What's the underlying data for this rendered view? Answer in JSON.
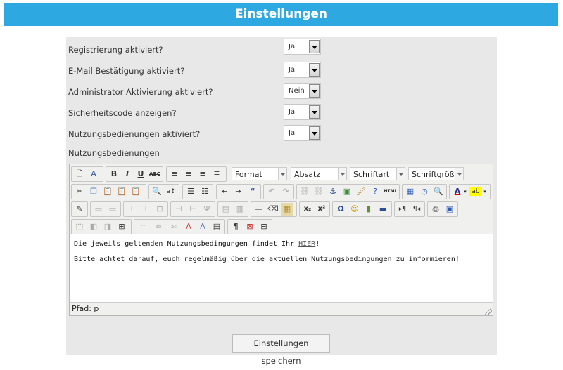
{
  "header": {
    "title": "Einstellungen"
  },
  "settings": [
    {
      "label": "Registrierung aktiviert?",
      "value": "Ja"
    },
    {
      "label": "E-Mail Bestätigung aktiviert?",
      "value": "Ja"
    },
    {
      "label": "Administrator Aktivierung aktiviert?",
      "value": "Nein"
    },
    {
      "label": "Sicherheitscode anzeigen?",
      "value": "Ja"
    },
    {
      "label": "Nutzungsbedienungen aktiviert?",
      "value": "Ja"
    }
  ],
  "editor_label": "Nutzungsbedienungen",
  "toolbar": {
    "format": "Format",
    "absatz": "Absatz",
    "schriftart": "Schriftart",
    "schriftgroesse": "Schriftgröße",
    "bold": "B",
    "italic": "I",
    "underline": "U",
    "strike": "ABC",
    "html": "HTML"
  },
  "content": {
    "line1_before": "Die jeweils geltenden Nutzungsbedingungen findet Ihr ",
    "line1_link": "HIER",
    "line1_after": "!",
    "line2": "Bitte achtet darauf, euch regelmäßig über die aktuellen Nutzungsbedingungen zu informieren!"
  },
  "status": {
    "path": "Pfad: p"
  },
  "save_label": "Einstellungen speichern"
}
